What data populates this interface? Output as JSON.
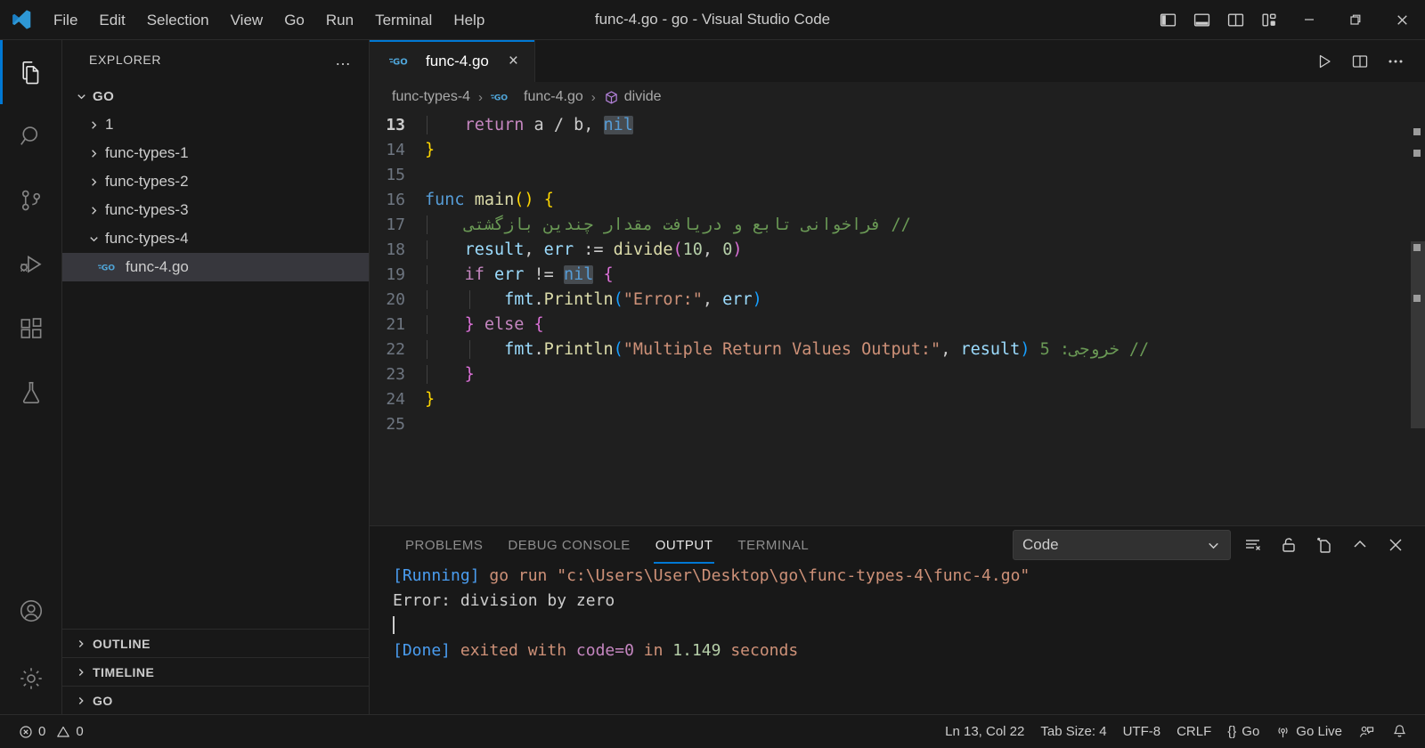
{
  "titlebar": {
    "window_title": "func-4.go - go - Visual Studio Code",
    "menus": [
      "File",
      "Edit",
      "Selection",
      "View",
      "Go",
      "Run",
      "Terminal",
      "Help"
    ],
    "layout_buttons": [
      "toggle-primary-sidebar",
      "toggle-panel",
      "toggle-secondary-sidebar",
      "customize-layout"
    ],
    "window_buttons": [
      "minimize",
      "restore",
      "close"
    ]
  },
  "activitybar": {
    "items": [
      {
        "name": "explorer",
        "icon": "files-icon",
        "active": true
      },
      {
        "name": "search",
        "icon": "search-icon",
        "active": false
      },
      {
        "name": "source-control",
        "icon": "source-control-icon",
        "active": false
      },
      {
        "name": "run-and-debug",
        "icon": "run-debug-icon",
        "active": false
      },
      {
        "name": "extensions",
        "icon": "extensions-icon",
        "active": false
      },
      {
        "name": "testing",
        "icon": "beaker-icon",
        "active": false
      }
    ],
    "bottom": [
      {
        "name": "accounts",
        "icon": "account-icon"
      },
      {
        "name": "settings",
        "icon": "gear-icon"
      }
    ]
  },
  "sidebar": {
    "title": "EXPLORER",
    "more_actions": "…",
    "tree": [
      {
        "label": "GO",
        "level": 0,
        "expanded": true,
        "type": "folder",
        "selected": false
      },
      {
        "label": "1",
        "level": 1,
        "expanded": false,
        "type": "folder",
        "selected": false
      },
      {
        "label": "func-types-1",
        "level": 1,
        "expanded": false,
        "type": "folder",
        "selected": false
      },
      {
        "label": "func-types-2",
        "level": 1,
        "expanded": false,
        "type": "folder",
        "selected": false
      },
      {
        "label": "func-types-3",
        "level": 1,
        "expanded": false,
        "type": "folder",
        "selected": false
      },
      {
        "label": "func-types-4",
        "level": 1,
        "expanded": true,
        "type": "folder",
        "selected": false
      },
      {
        "label": "func-4.go",
        "level": 2,
        "expanded": null,
        "type": "go-file",
        "selected": true
      }
    ],
    "sections": [
      {
        "label": "OUTLINE",
        "expanded": false
      },
      {
        "label": "TIMELINE",
        "expanded": false
      },
      {
        "label": "GO",
        "expanded": false
      }
    ]
  },
  "editor": {
    "tab": {
      "label": "func-4.go",
      "icon": "go-file-icon",
      "close": "×",
      "active": true
    },
    "actions": [
      "run-code-button",
      "split-editor-button",
      "more-actions-button"
    ],
    "breadcrumb": [
      {
        "label": "func-types-4",
        "icon": null
      },
      {
        "label": "func-4.go",
        "icon": "go-file-icon"
      },
      {
        "label": "divide",
        "icon": "symbol-method-icon"
      }
    ],
    "first_visible_line": 13,
    "lines": [
      {
        "num": 13,
        "current": true,
        "indent": 1,
        "tokens": [
          {
            "t": "return ",
            "c": "t-kw"
          },
          {
            "t": "a ",
            "c": "t-punc"
          },
          {
            "t": "/ ",
            "c": "t-punc"
          },
          {
            "t": "b",
            "c": "t-punc"
          },
          {
            "t": ", ",
            "c": "t-punc"
          },
          {
            "t": "nil",
            "c": "t-nil"
          }
        ]
      },
      {
        "num": 14,
        "current": false,
        "indent": 0,
        "tokens": [
          {
            "t": "}",
            "c": "t-br-y"
          }
        ]
      },
      {
        "num": 15,
        "current": false,
        "indent": 0,
        "tokens": []
      },
      {
        "num": 16,
        "current": false,
        "indent": 0,
        "tokens": [
          {
            "t": "func ",
            "c": "t-kw2"
          },
          {
            "t": "main",
            "c": "t-fn"
          },
          {
            "t": "()",
            "c": "t-br-y"
          },
          {
            "t": " ",
            "c": "t-punc"
          },
          {
            "t": "{",
            "c": "t-br-y"
          }
        ]
      },
      {
        "num": 17,
        "current": false,
        "indent": 1,
        "rtl_comment": "// فراخوانی تابع و دریافت مقدار چندین بازگشتی",
        "tokens": []
      },
      {
        "num": 18,
        "current": false,
        "indent": 1,
        "tokens": [
          {
            "t": "result",
            "c": "t-var"
          },
          {
            "t": ", ",
            "c": "t-punc"
          },
          {
            "t": "err ",
            "c": "t-var"
          },
          {
            "t": ":= ",
            "c": "t-punc"
          },
          {
            "t": "divide",
            "c": "t-fn"
          },
          {
            "t": "(",
            "c": "t-br-p"
          },
          {
            "t": "10",
            "c": "t-num"
          },
          {
            "t": ", ",
            "c": "t-punc"
          },
          {
            "t": "0",
            "c": "t-num"
          },
          {
            "t": ")",
            "c": "t-br-p"
          }
        ]
      },
      {
        "num": 19,
        "current": false,
        "indent": 1,
        "tokens": [
          {
            "t": "if ",
            "c": "t-kw"
          },
          {
            "t": "err ",
            "c": "t-var"
          },
          {
            "t": "!= ",
            "c": "t-punc"
          },
          {
            "t": "nil",
            "c": "t-nil"
          },
          {
            "t": " ",
            "c": "t-punc"
          },
          {
            "t": "{",
            "c": "t-br-p"
          }
        ]
      },
      {
        "num": 20,
        "current": false,
        "indent": 2,
        "tokens": [
          {
            "t": "fmt",
            "c": "t-var"
          },
          {
            "t": ".",
            "c": "t-punc"
          },
          {
            "t": "Println",
            "c": "t-fn"
          },
          {
            "t": "(",
            "c": "t-br-b"
          },
          {
            "t": "\"Error:\"",
            "c": "t-str"
          },
          {
            "t": ", ",
            "c": "t-punc"
          },
          {
            "t": "err",
            "c": "t-var"
          },
          {
            "t": ")",
            "c": "t-br-b"
          }
        ]
      },
      {
        "num": 21,
        "current": false,
        "indent": 1,
        "tokens": [
          {
            "t": "}",
            "c": "t-br-p"
          },
          {
            "t": " ",
            "c": "t-punc"
          },
          {
            "t": "else",
            "c": "t-kw"
          },
          {
            "t": " ",
            "c": "t-punc"
          },
          {
            "t": "{",
            "c": "t-br-p"
          }
        ]
      },
      {
        "num": 22,
        "current": false,
        "indent": 2,
        "rtl_comment_tail": "// خروجی: 5",
        "tokens": [
          {
            "t": "fmt",
            "c": "t-var"
          },
          {
            "t": ".",
            "c": "t-punc"
          },
          {
            "t": "Println",
            "c": "t-fn"
          },
          {
            "t": "(",
            "c": "t-br-b"
          },
          {
            "t": "\"Multiple Return Values Output:\"",
            "c": "t-str"
          },
          {
            "t": ", ",
            "c": "t-punc"
          },
          {
            "t": "result",
            "c": "t-var"
          },
          {
            "t": ")",
            "c": "t-br-b"
          },
          {
            "t": " ",
            "c": "t-punc"
          }
        ]
      },
      {
        "num": 23,
        "current": false,
        "indent": 1,
        "tokens": [
          {
            "t": "}",
            "c": "t-br-p"
          }
        ]
      },
      {
        "num": 24,
        "current": false,
        "indent": 0,
        "tokens": [
          {
            "t": "}",
            "c": "t-br-y"
          }
        ]
      },
      {
        "num": 25,
        "current": false,
        "indent": 0,
        "tokens": []
      }
    ]
  },
  "panel": {
    "tabs": [
      {
        "label": "PROBLEMS",
        "active": false
      },
      {
        "label": "DEBUG CONSOLE",
        "active": false
      },
      {
        "label": "OUTPUT",
        "active": true
      },
      {
        "label": "TERMINAL",
        "active": false
      }
    ],
    "channel_select": {
      "value": "Code",
      "chevron": "⌄"
    },
    "actions": [
      "clear-output-button",
      "lock-scroll-button",
      "open-in-editor-button",
      "maximize-panel-button",
      "close-panel-button"
    ],
    "output": [
      {
        "segments": [
          {
            "t": "[Running] ",
            "c": "o-blue"
          },
          {
            "t": "go run \"c:\\Users\\User\\Desktop\\go\\func-types-4\\func-4.go\"",
            "c": "o-orange"
          }
        ]
      },
      {
        "segments": [
          {
            "t": "Error: division by zero",
            "c": "o-white"
          }
        ]
      },
      {
        "segments": [],
        "caret": true
      },
      {
        "segments": [
          {
            "t": "[Done] ",
            "c": "o-blue"
          },
          {
            "t": "exited with ",
            "c": "o-orange"
          },
          {
            "t": "code=0",
            "c": "o-purple"
          },
          {
            "t": " in ",
            "c": "o-orange"
          },
          {
            "t": "1.149",
            "c": "o-green"
          },
          {
            "t": " seconds",
            "c": "o-orange"
          }
        ]
      }
    ]
  },
  "statusbar": {
    "errors": "0",
    "warnings": "0",
    "cursor_position": "Ln 13, Col 22",
    "tab_size": "Tab Size: 4",
    "encoding": "UTF-8",
    "eol": "CRLF",
    "language": "Go",
    "go_live": "Go Live",
    "right_icons": [
      "remote-feedback-icon",
      "notifications-bell-icon"
    ]
  },
  "colors": {
    "accent": "#0078d4",
    "titlebar_bg": "#181818",
    "editor_bg": "#1f1f1f",
    "selection": "#37373d"
  }
}
